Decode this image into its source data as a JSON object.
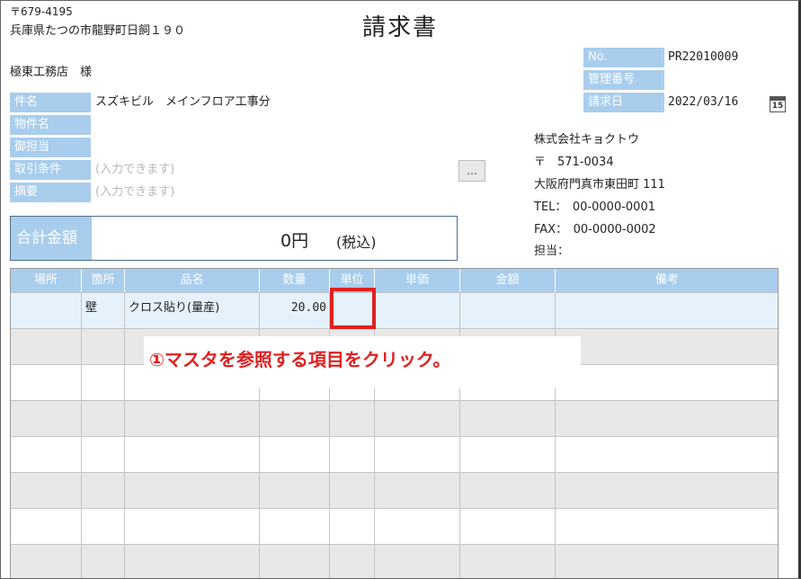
{
  "colors": {
    "label_bg": "#a9cdec",
    "row_selected": "#e6f2fb",
    "row_alt": "#e8e8e8",
    "callout_red": "#e02020"
  },
  "customer": {
    "postal": "〒679-4195",
    "address": "兵庫県たつの市龍野町日飼１９０",
    "name": "極東工務店　様"
  },
  "title": "請求書",
  "doc_info": [
    {
      "label": "No.",
      "value": "PR22010009"
    },
    {
      "label": "管理番号",
      "value": ""
    },
    {
      "label": "請求日",
      "value": "2022/03/16"
    }
  ],
  "calendar_icon": {
    "name": "calendar-icon",
    "text": "15"
  },
  "fields": [
    {
      "label": "件名",
      "value": "スズキビル　メインフロア工事分",
      "placeholder": false
    },
    {
      "label": "物件名",
      "value": "",
      "placeholder": false
    },
    {
      "label": "御担当",
      "value": "",
      "placeholder": false
    },
    {
      "label": "取引条件",
      "value": "(入力できます)",
      "placeholder": true
    },
    {
      "label": "摘要",
      "value": "(入力できます)",
      "placeholder": true
    }
  ],
  "ellipsis_button": "…",
  "total": {
    "label": "合計金額",
    "amount": "0円",
    "tax_note": "(税込)"
  },
  "company": {
    "name": "株式会社キョクトウ",
    "postal": "〒　571-0034",
    "address": "大阪府門真市東田町 111",
    "tel": "TEL：　00-0000-0001",
    "fax": "FAX：　00-0000-0002",
    "person": "担当："
  },
  "table": {
    "columns": [
      "場所",
      "箇所",
      "品名",
      "数量",
      "単位",
      "単価",
      "金額",
      "備考"
    ],
    "rows": [
      [
        "",
        "壁",
        "クロス貼り(量産)",
        "20.00",
        "",
        "",
        "",
        ""
      ],
      [
        "",
        "",
        "",
        "",
        "",
        "",
        "",
        ""
      ],
      [
        "",
        "",
        "",
        "",
        "",
        "",
        "",
        ""
      ],
      [
        "",
        "",
        "",
        "",
        "",
        "",
        "",
        ""
      ],
      [
        "",
        "",
        "",
        "",
        "",
        "",
        "",
        ""
      ],
      [
        "",
        "",
        "",
        "",
        "",
        "",
        "",
        ""
      ],
      [
        "",
        "",
        "",
        "",
        "",
        "",
        "",
        ""
      ],
      [
        "",
        "",
        "",
        "",
        "",
        "",
        "",
        ""
      ]
    ]
  },
  "callout": "①マスタを参照する項目をクリック。"
}
